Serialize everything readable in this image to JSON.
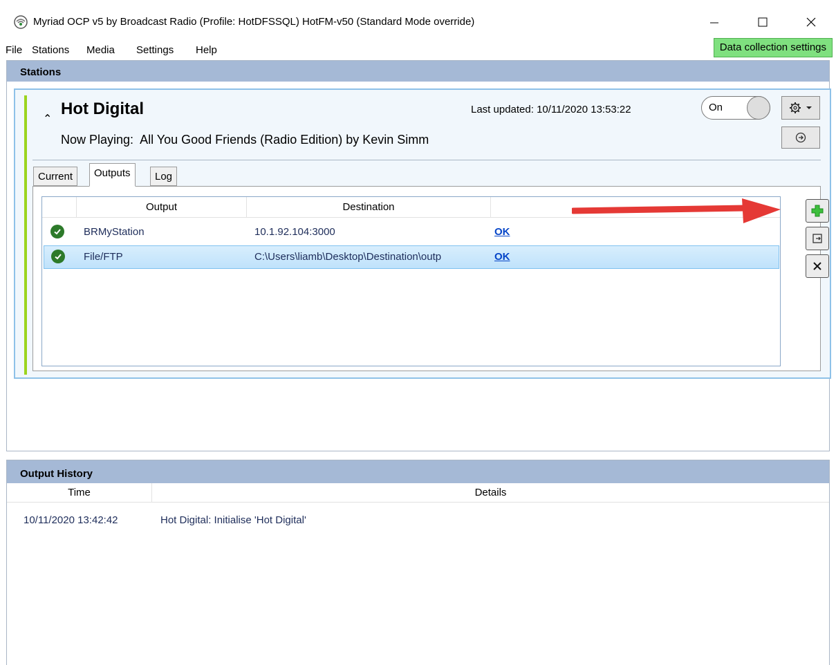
{
  "window": {
    "title": "Myriad OCP v5 by Broadcast Radio (Profile: HotDFSSQL) HotFM-v50 (Standard Mode override)"
  },
  "menu": {
    "items": [
      "File",
      "Stations",
      "Media",
      "Settings",
      "Help"
    ],
    "data_collection_label": "Data collection settings"
  },
  "stations_panel": {
    "header": "Stations",
    "station": {
      "name": "Hot Digital",
      "last_updated_label": "Last updated:",
      "last_updated_value": "10/11/2020 13:53:22",
      "now_playing_label": "Now Playing:",
      "now_playing_value": "All You Good Friends (Radio Edition) by Kevin Simm",
      "toggle_label": "On",
      "tabs": [
        "Current",
        "Outputs",
        "Log"
      ],
      "active_tab": "Outputs",
      "outputs_table": {
        "columns": [
          "Output",
          "Destination"
        ],
        "rows": [
          {
            "output": "BRMyStation",
            "destination": "10.1.92.104:3000",
            "status": "OK"
          },
          {
            "output": "File/FTP",
            "destination": "C:\\Users\\liamb\\Desktop\\Destination\\outp",
            "status": "OK"
          }
        ]
      }
    }
  },
  "output_history": {
    "header": "Output History",
    "columns": [
      "Time",
      "Details"
    ],
    "rows": [
      {
        "time": "10/11/2020 13:42:42",
        "details": "Hot Digital: Initialise 'Hot Digital'"
      }
    ]
  },
  "colors": {
    "panel_header": "#a5b9d6",
    "accent_green": "#9bd41e",
    "annotation_arrow": "#e53935",
    "data_collection_bg": "#7fe07f"
  },
  "icons": [
    "app-logo-icon",
    "minimize-icon",
    "maximize-icon",
    "close-icon",
    "gear-icon",
    "dropdown-caret-icon",
    "go-arrow-icon",
    "check-icon",
    "add-icon",
    "export-icon",
    "delete-icon"
  ]
}
